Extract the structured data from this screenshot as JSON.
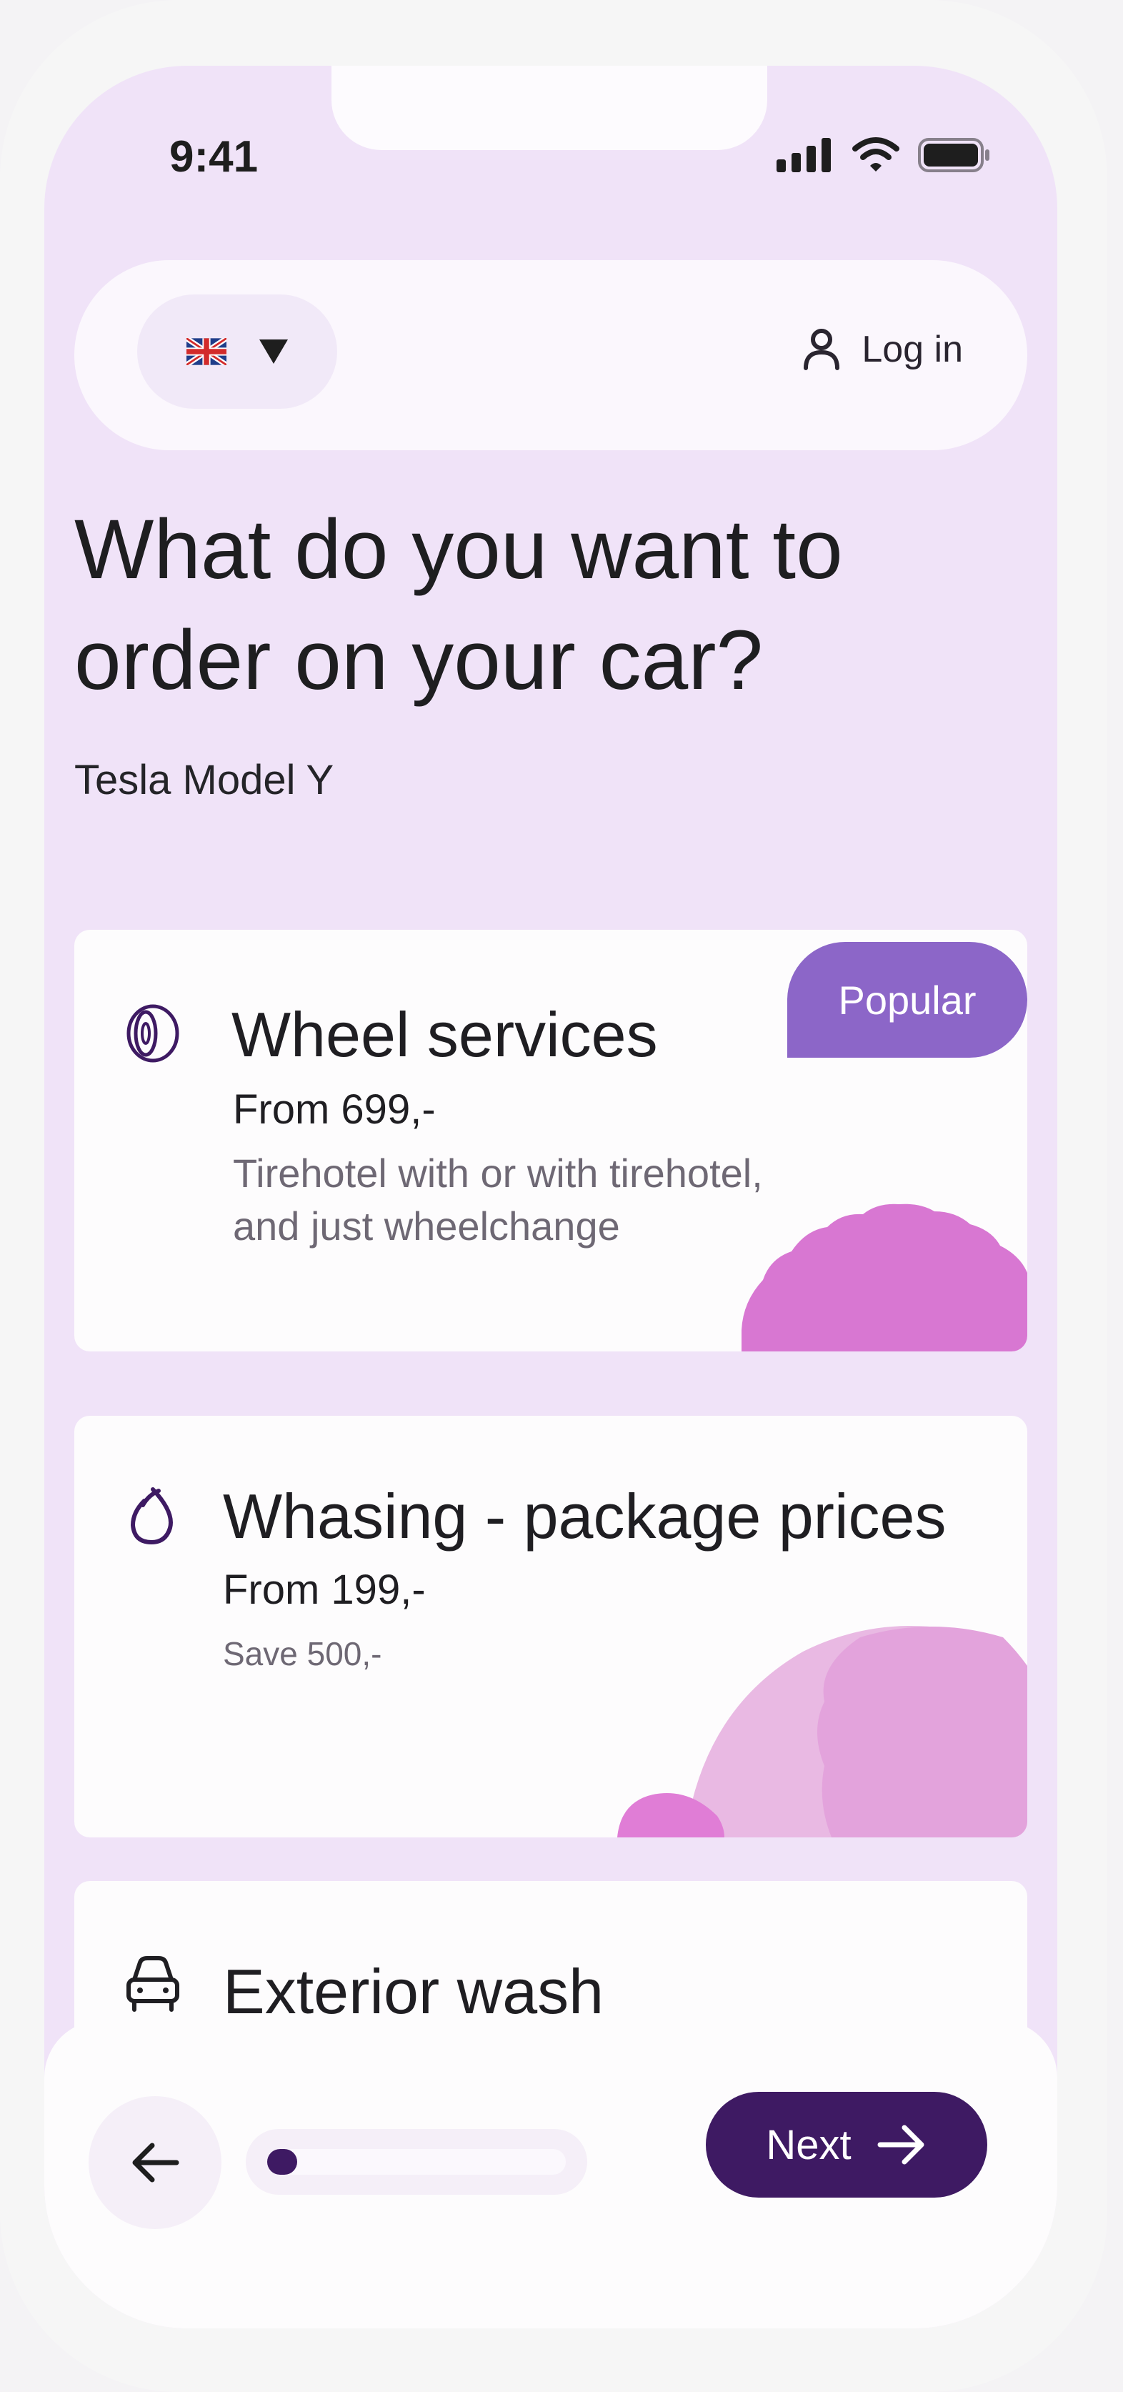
{
  "status_bar": {
    "time": "9:41"
  },
  "header": {
    "language_icon": "uk-flag-icon",
    "dropdown_icon": "caret-down-icon",
    "login_icon": "user-icon",
    "login_label": "Log in"
  },
  "page": {
    "title": "What do you want to order on your car?",
    "car_model": "Tesla Model Y"
  },
  "services": [
    {
      "icon": "tire-icon",
      "title": "Wheel services",
      "price": "From 699,-",
      "description": "Tirehotel with or with tirehotel, and just wheelchange",
      "badge": "Popular"
    },
    {
      "icon": "droplet-icon",
      "title": "Whasing - package prices",
      "price": "From 199,-",
      "description": "Save 500,-"
    },
    {
      "icon": "car-icon",
      "title": "Exterior wash"
    }
  ],
  "footer": {
    "back_icon": "arrow-left-icon",
    "progress_fraction": 0.1,
    "next_label": "Next",
    "next_icon": "arrow-right-icon"
  },
  "colors": {
    "background": "#f0e3f8",
    "accent_dark": "#3e1a63",
    "badge": "#8c66c8",
    "blob_pink": "#d877d2",
    "blob_light": "#e8abdf"
  }
}
